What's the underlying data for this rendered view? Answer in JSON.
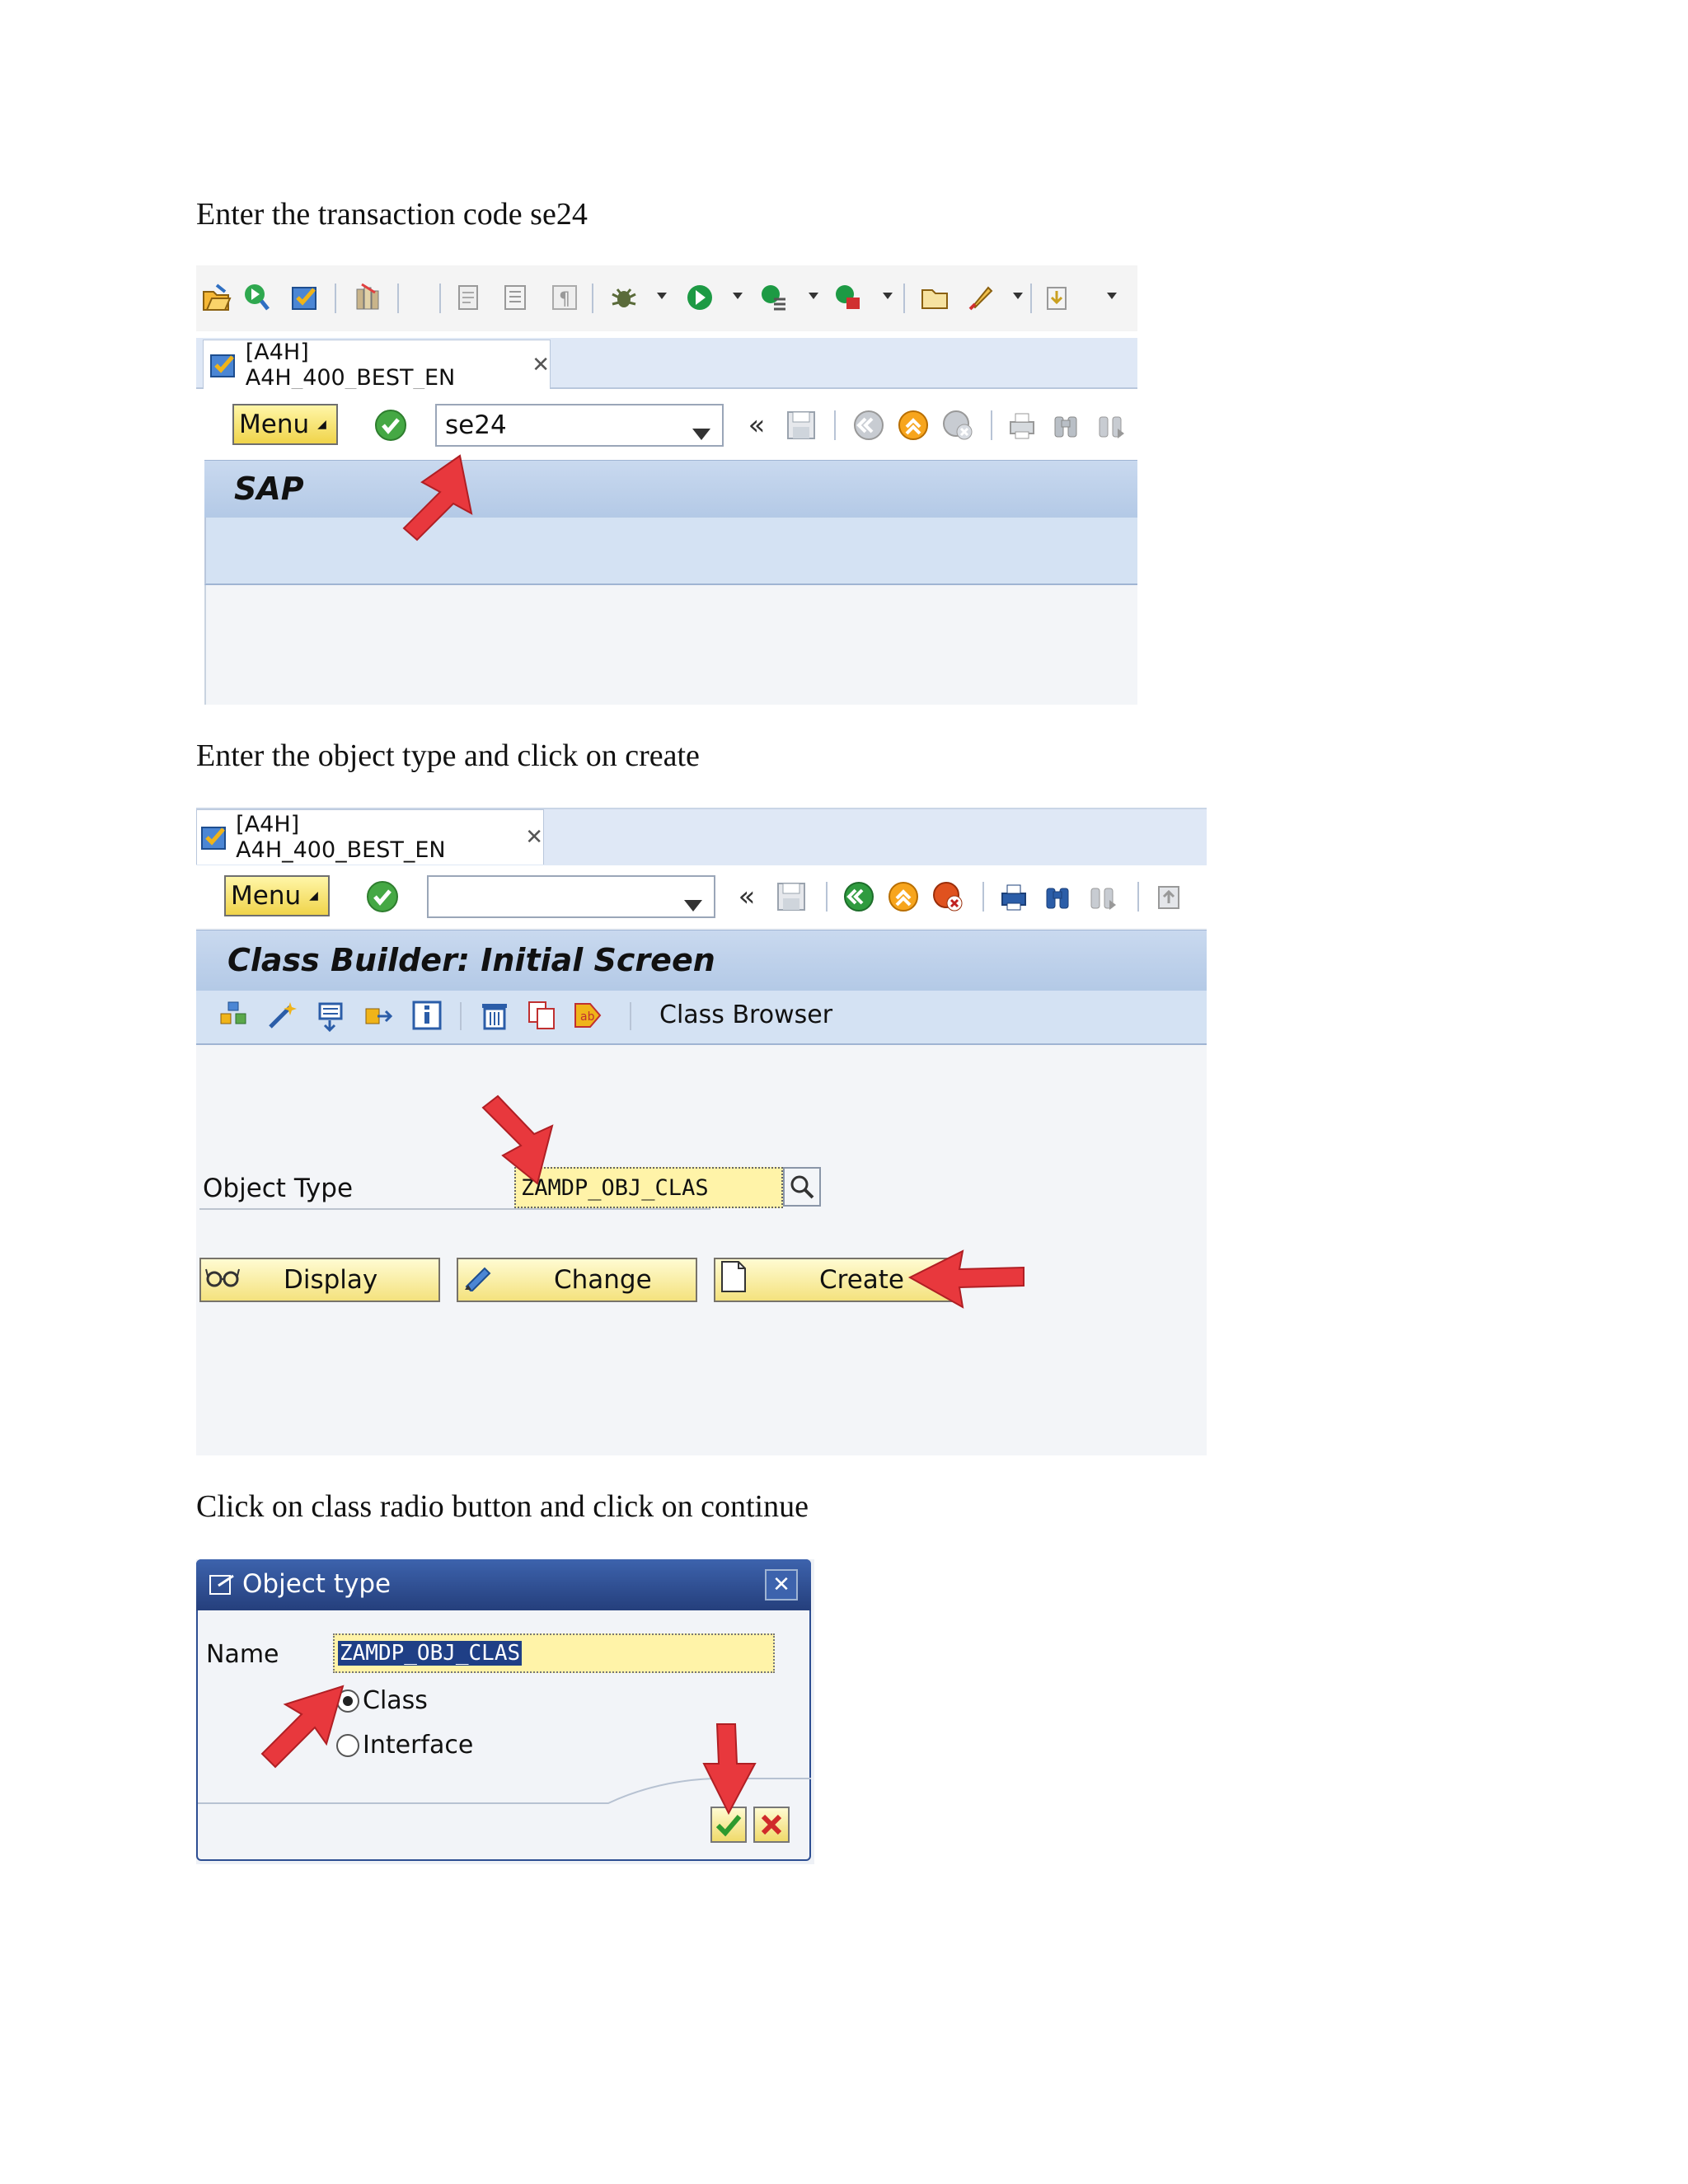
{
  "captions": {
    "step1": "Enter the transaction code  se24",
    "step2": "Enter the object type and click on create",
    "step3": "Click on class radio button and click on continue"
  },
  "shot1": {
    "tab_label": "[A4H] A4H_400_BEST_EN",
    "menu_label": "Menu",
    "command_value": "se24",
    "title": "SAP"
  },
  "shot2": {
    "tab_label": "[A4H] A4H_400_BEST_EN",
    "menu_label": "Menu",
    "command_value": "",
    "title": "Class Builder: Initial Screen",
    "class_browser_label": "Class Browser",
    "object_type_label": "Object Type",
    "object_type_value": "ZAMDP_OBJ_CLAS",
    "display_label": "Display",
    "change_label": "Change",
    "create_label": "Create"
  },
  "shot3": {
    "dialog_title": "Object type",
    "name_label": "Name",
    "name_value": "ZAMDP_OBJ_CLAS",
    "class_label": "Class",
    "interface_label": "Interface",
    "class_selected": true
  },
  "colors": {
    "sap_blue": "#c9d9ef",
    "field_yellow": "#fff3a8",
    "annotation_red": "#e8383d",
    "dialog_header": "#2d4e92"
  }
}
